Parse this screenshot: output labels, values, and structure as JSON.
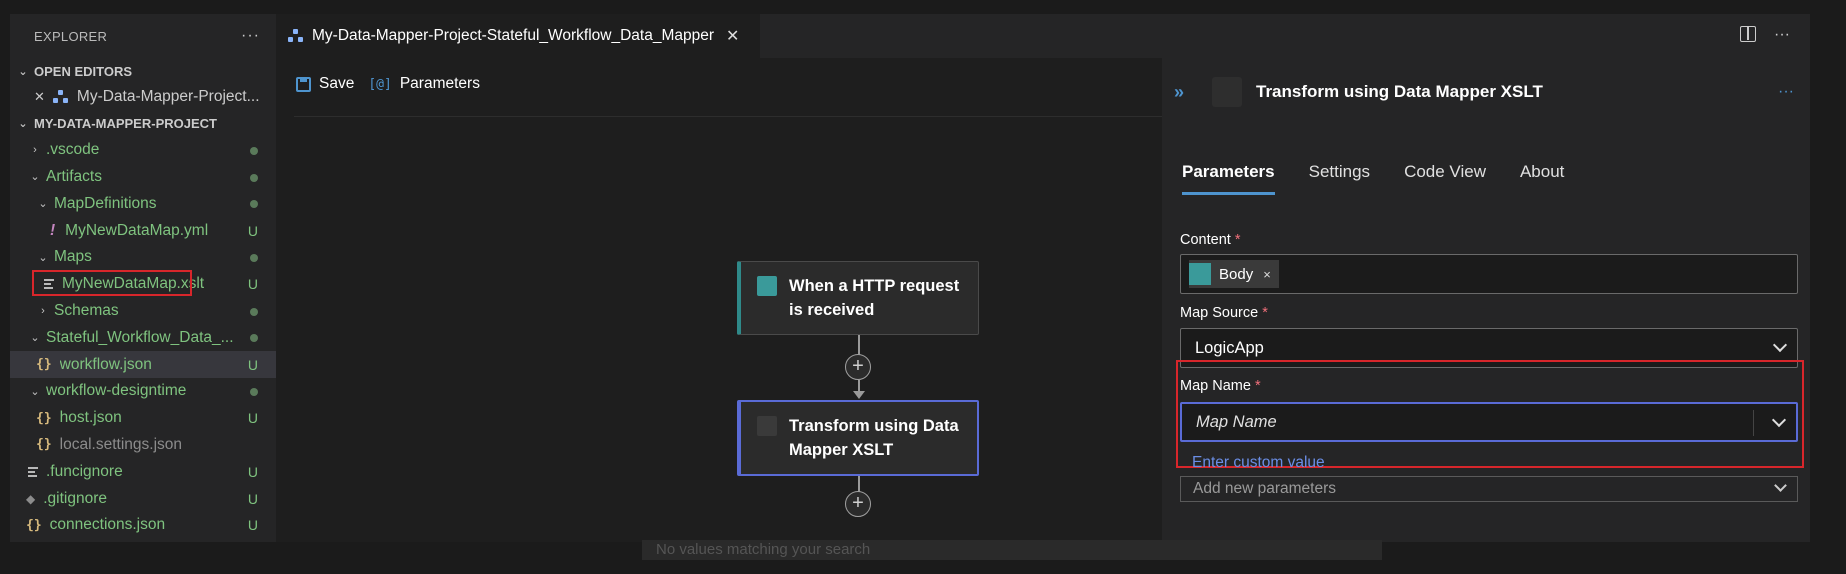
{
  "sidebar": {
    "title": "EXPLORER",
    "more": "···",
    "open_editors": {
      "label": "OPEN EDITORS",
      "items": [
        {
          "close": "✕",
          "label": "My-Data-Mapper-Project..."
        }
      ]
    },
    "project": {
      "label": "MY-DATA-MAPPER-PROJECT",
      "rows": [
        {
          "label": ".vscode",
          "badge": "",
          "chev": "›"
        },
        {
          "label": "Artifacts",
          "badge": "",
          "chev": "⌄"
        },
        {
          "label": "MapDefinitions",
          "badge": "",
          "chev": "⌄"
        },
        {
          "label": "MyNewDataMap.yml",
          "badge": "U",
          "icon": "!"
        },
        {
          "label": "Maps",
          "badge": "",
          "chev": "⌄"
        },
        {
          "label": "MyNewDataMap.xslt",
          "badge": "U"
        },
        {
          "label": "Schemas",
          "badge": "",
          "chev": "›"
        },
        {
          "label": "Stateful_Workflow_Data_...",
          "badge": "",
          "chev": "⌄"
        },
        {
          "label": "workflow.json",
          "badge": "U",
          "icon": "{}"
        },
        {
          "label": "workflow-designtime",
          "badge": "",
          "chev": "⌄"
        },
        {
          "label": "host.json",
          "badge": "U",
          "icon": "{}"
        },
        {
          "label": "local.settings.json",
          "badge": "",
          "icon": "{}"
        },
        {
          "label": ".funcignore",
          "badge": "U"
        },
        {
          "label": ".gitignore",
          "badge": "U",
          "icon": "◆"
        },
        {
          "label": "connections.json",
          "badge": "U",
          "icon": "{}"
        }
      ]
    }
  },
  "editor": {
    "tab_title": "My-Data-Mapper-Project-Stateful_Workflow_Data_Mapper",
    "tab_close": "✕",
    "more": "···"
  },
  "toolbar": {
    "save_label": "Save",
    "parameters_label": "Parameters",
    "parameters_icon_text": "[@]"
  },
  "canvas": {
    "trigger_title": "When a HTTP request is received",
    "action_title": "Transform using Data Mapper XSLT",
    "plus": "+"
  },
  "panel": {
    "expand": "»",
    "title": "Transform using Data Mapper XSLT",
    "more": "···",
    "tabs": [
      "Parameters",
      "Settings",
      "Code View",
      "About"
    ],
    "active_tab": 0,
    "content_label": "Content",
    "required_mark": "*",
    "content_token": "Body",
    "token_close": "×",
    "map_source_label": "Map Source",
    "map_source_value": "LogicApp",
    "map_name_label": "Map Name",
    "map_name_placeholder": "Map Name",
    "custom_value_link": "Enter custom value",
    "add_new_parameters": "Add new parameters"
  },
  "overlay": {
    "no_match_text": "No values matching your search"
  }
}
